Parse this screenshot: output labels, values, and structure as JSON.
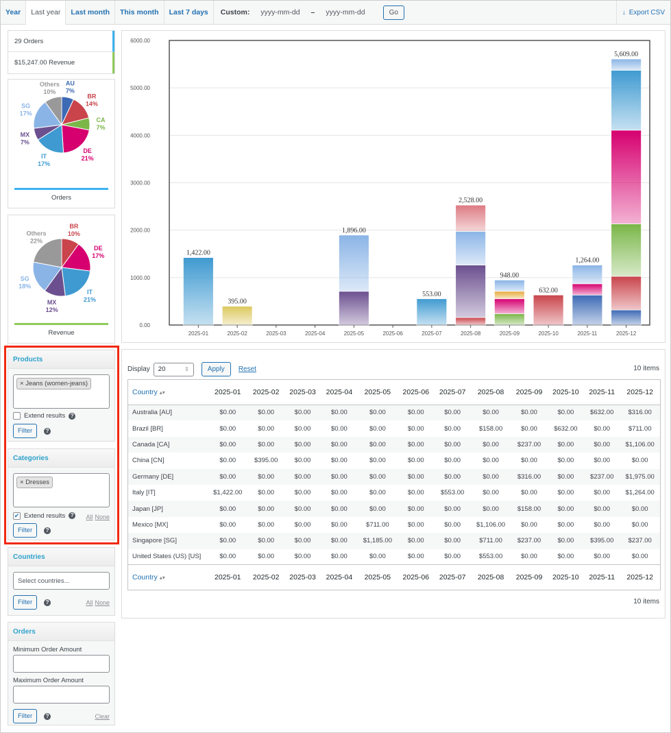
{
  "tabs": [
    "Year",
    "Last year",
    "Last month",
    "This month",
    "Last 7 days"
  ],
  "active_tab": 1,
  "custom": {
    "label": "Custom:",
    "from_placeholder": "yyyy-mm-dd",
    "sep": "–",
    "to_placeholder": "yyyy-mm-dd",
    "go": "Go"
  },
  "export": "Export CSV",
  "stats": {
    "orders": "29 Orders",
    "revenue": "$15,247.00 Revenue",
    "orders_color": "#3db2ef",
    "revenue_color": "#8fca5a"
  },
  "pies": [
    {
      "caption": "Orders",
      "bar_color": "#3db2ef",
      "slices": [
        {
          "label": "AU",
          "pct": 7,
          "color": "#3d6ab5"
        },
        {
          "label": "BR",
          "pct": 14,
          "color": "#c9444b"
        },
        {
          "label": "CA",
          "pct": 7,
          "color": "#7ab648"
        },
        {
          "label": "DE",
          "pct": 21,
          "color": "#d6006f"
        },
        {
          "label": "IT",
          "pct": 17,
          "color": "#3f9ad1"
        },
        {
          "label": "MX",
          "pct": 7,
          "color": "#6b4f8f"
        },
        {
          "label": "SG",
          "pct": 17,
          "color": "#8ab4e6"
        },
        {
          "label": "Others",
          "pct": 10,
          "color": "#999999"
        }
      ]
    },
    {
      "caption": "Revenue",
      "bar_color": "#8fca5a",
      "slices": [
        {
          "label": "BR",
          "pct": 10,
          "color": "#c9444b"
        },
        {
          "label": "DE",
          "pct": 17,
          "color": "#d6006f"
        },
        {
          "label": "IT",
          "pct": 21,
          "color": "#3f9ad1"
        },
        {
          "label": "MX",
          "pct": 12,
          "color": "#6b4f8f"
        },
        {
          "label": "SG",
          "pct": 18,
          "color": "#8ab4e6"
        },
        {
          "label": "Others",
          "pct": 22,
          "color": "#999999"
        }
      ]
    }
  ],
  "filters": {
    "products": {
      "title": "Products",
      "chip": "Jeans (women-jeans)",
      "extend": "Extend results",
      "extend_checked": false,
      "filter": "Filter"
    },
    "categories": {
      "title": "Categories",
      "chip": "Dresses",
      "extend": "Extend results",
      "extend_checked": true,
      "all": "All",
      "none": "None",
      "filter": "Filter"
    },
    "countries": {
      "title": "Countries",
      "placeholder": "Select countries...",
      "filter": "Filter",
      "all": "All",
      "none": "None"
    },
    "orders": {
      "title": "Orders",
      "min_label": "Minimum Order Amount",
      "max_label": "Maximum Order Amount",
      "filter": "Filter",
      "clear": "Clear"
    }
  },
  "chart_data": {
    "type": "bar",
    "stacked": true,
    "categories": [
      "2025-01",
      "2025-02",
      "2025-03",
      "2025-04",
      "2025-05",
      "2025-06",
      "2025-07",
      "2025-08",
      "2025-09",
      "2025-10",
      "2025-11",
      "2025-12"
    ],
    "ylim": [
      0,
      6000
    ],
    "yticks": [
      "0.00",
      "1000.00",
      "2000.00",
      "3000.00",
      "4000.00",
      "5000.00",
      "6000.00"
    ],
    "totals": [
      "1,422.00",
      "395.00",
      "",
      "",
      "1,896.00",
      "",
      "553.00",
      "2,528.00",
      "948.00",
      "632.00",
      "1,264.00",
      "5,609.00"
    ],
    "series": [
      {
        "name": "AU",
        "color": "#3d6ab5",
        "values": [
          0,
          0,
          0,
          0,
          0,
          0,
          0,
          0,
          0,
          0,
          632,
          316
        ]
      },
      {
        "name": "BR",
        "color": "#c9444b",
        "values": [
          0,
          0,
          0,
          0,
          0,
          0,
          0,
          158,
          0,
          632,
          0,
          711
        ]
      },
      {
        "name": "CA",
        "color": "#7ab648",
        "values": [
          0,
          0,
          0,
          0,
          0,
          0,
          0,
          0,
          237,
          0,
          0,
          1106
        ]
      },
      {
        "name": "CN",
        "color": "#dcc85e",
        "values": [
          0,
          395,
          0,
          0,
          0,
          0,
          0,
          0,
          0,
          0,
          0,
          0
        ]
      },
      {
        "name": "DE",
        "color": "#d6006f",
        "values": [
          0,
          0,
          0,
          0,
          0,
          0,
          0,
          0,
          316,
          0,
          237,
          1975
        ]
      },
      {
        "name": "IT",
        "color": "#3f9ad1",
        "values": [
          1422,
          0,
          0,
          0,
          0,
          0,
          553,
          0,
          0,
          0,
          0,
          1264
        ]
      },
      {
        "name": "JP",
        "color": "#e6a93a",
        "values": [
          0,
          0,
          0,
          0,
          0,
          0,
          0,
          0,
          158,
          0,
          0,
          0
        ]
      },
      {
        "name": "MX",
        "color": "#6b4f8f",
        "values": [
          0,
          0,
          0,
          0,
          711,
          0,
          0,
          1106,
          0,
          0,
          0,
          0
        ]
      },
      {
        "name": "SG",
        "color": "#8ab4e6",
        "values": [
          0,
          0,
          0,
          0,
          1185,
          0,
          0,
          711,
          237,
          0,
          395,
          237
        ]
      },
      {
        "name": "US",
        "color": "#dd7a82",
        "values": [
          0,
          0,
          0,
          0,
          0,
          0,
          0,
          553,
          0,
          0,
          0,
          0
        ]
      }
    ]
  },
  "table": {
    "display_label": "Display",
    "display_value": "20",
    "apply": "Apply",
    "reset": "Reset",
    "items": "10 items",
    "country_header": "Country",
    "months": [
      "2025-01",
      "2025-02",
      "2025-03",
      "2025-04",
      "2025-05",
      "2025-06",
      "2025-07",
      "2025-08",
      "2025-09",
      "2025-10",
      "2025-11",
      "2025-12"
    ],
    "rows": [
      {
        "country": "Australia [AU]",
        "values": [
          "$0.00",
          "$0.00",
          "$0.00",
          "$0.00",
          "$0.00",
          "$0.00",
          "$0.00",
          "$0.00",
          "$0.00",
          "$0.00",
          "$632.00",
          "$316.00"
        ]
      },
      {
        "country": "Brazil [BR]",
        "values": [
          "$0.00",
          "$0.00",
          "$0.00",
          "$0.00",
          "$0.00",
          "$0.00",
          "$0.00",
          "$158.00",
          "$0.00",
          "$632.00",
          "$0.00",
          "$711.00"
        ]
      },
      {
        "country": "Canada [CA]",
        "values": [
          "$0.00",
          "$0.00",
          "$0.00",
          "$0.00",
          "$0.00",
          "$0.00",
          "$0.00",
          "$0.00",
          "$237.00",
          "$0.00",
          "$0.00",
          "$1,106.00"
        ]
      },
      {
        "country": "China [CN]",
        "values": [
          "$0.00",
          "$395.00",
          "$0.00",
          "$0.00",
          "$0.00",
          "$0.00",
          "$0.00",
          "$0.00",
          "$0.00",
          "$0.00",
          "$0.00",
          "$0.00"
        ]
      },
      {
        "country": "Germany [DE]",
        "values": [
          "$0.00",
          "$0.00",
          "$0.00",
          "$0.00",
          "$0.00",
          "$0.00",
          "$0.00",
          "$0.00",
          "$316.00",
          "$0.00",
          "$237.00",
          "$1,975.00"
        ]
      },
      {
        "country": "Italy [IT]",
        "values": [
          "$1,422.00",
          "$0.00",
          "$0.00",
          "$0.00",
          "$0.00",
          "$0.00",
          "$553.00",
          "$0.00",
          "$0.00",
          "$0.00",
          "$0.00",
          "$1,264.00"
        ]
      },
      {
        "country": "Japan [JP]",
        "values": [
          "$0.00",
          "$0.00",
          "$0.00",
          "$0.00",
          "$0.00",
          "$0.00",
          "$0.00",
          "$0.00",
          "$158.00",
          "$0.00",
          "$0.00",
          "$0.00"
        ]
      },
      {
        "country": "Mexico [MX]",
        "values": [
          "$0.00",
          "$0.00",
          "$0.00",
          "$0.00",
          "$711.00",
          "$0.00",
          "$0.00",
          "$1,106.00",
          "$0.00",
          "$0.00",
          "$0.00",
          "$0.00"
        ]
      },
      {
        "country": "Singapore [SG]",
        "values": [
          "$0.00",
          "$0.00",
          "$0.00",
          "$0.00",
          "$1,185.00",
          "$0.00",
          "$0.00",
          "$711.00",
          "$237.00",
          "$0.00",
          "$395.00",
          "$237.00"
        ]
      },
      {
        "country": "United States (US) [US]",
        "values": [
          "$0.00",
          "$0.00",
          "$0.00",
          "$0.00",
          "$0.00",
          "$0.00",
          "$0.00",
          "$553.00",
          "$0.00",
          "$0.00",
          "$0.00",
          "$0.00"
        ]
      }
    ]
  }
}
